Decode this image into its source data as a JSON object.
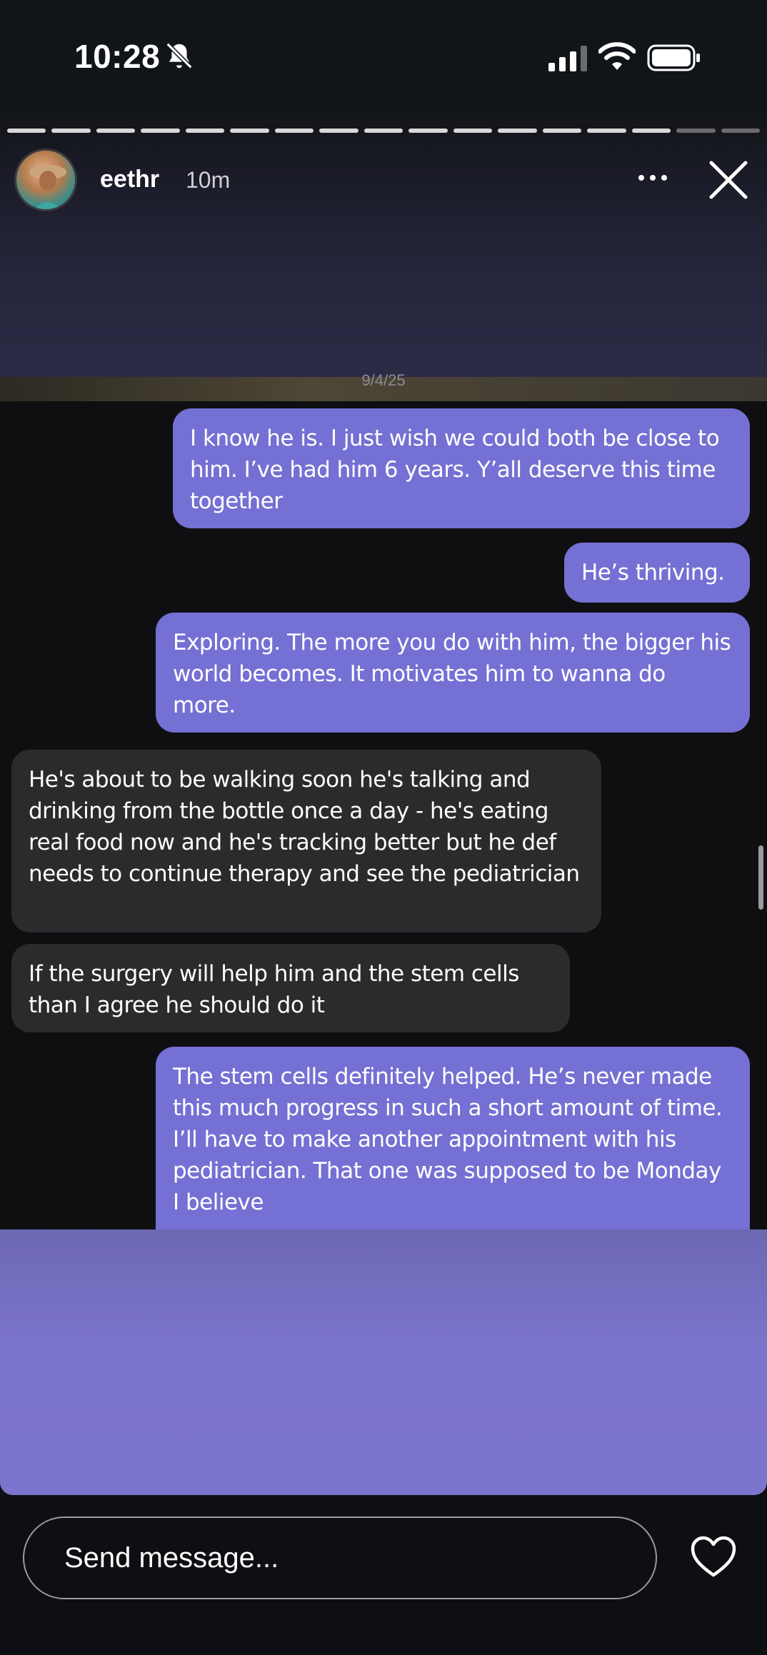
{
  "status_bar": {
    "time": "10:28",
    "icons": [
      "bell-off-icon",
      "cellular-signal-icon",
      "wifi-icon",
      "battery-icon"
    ]
  },
  "story": {
    "username": "eethr",
    "age": "10m",
    "progress": {
      "total_segments": 17,
      "completed_segments": 15
    },
    "icons": [
      "more-icon",
      "close-icon"
    ]
  },
  "screenshot": {
    "date": "9/4/25",
    "messages": [
      {
        "side": "sent",
        "text": "I know he is. I just wish we could both be close to him. I’ve had him 6 years. Y’all deserve this time together"
      },
      {
        "side": "sent",
        "text": "He’s thriving."
      },
      {
        "side": "sent",
        "text": "Exploring. The more you do with him, the bigger his world becomes. It motivates him to wanna do more."
      },
      {
        "side": "received",
        "text": "He's about to be walking soon he's talking and drinking from the bottle once a day - he's eating real food now and he's tracking better but he def needs to continue therapy and see the pediatrician"
      },
      {
        "side": "received",
        "text": "If the surgery will help him and the stem cells than I agree he should do it"
      },
      {
        "side": "sent",
        "text": "The stem cells definitely helped. He’s never made this much progress in such a short amount of time. I’ll have to make another appointment with his pediatrician. That one was supposed to be Monday I believe"
      }
    ]
  },
  "footer": {
    "placeholder": "Send message...",
    "icons": [
      "heart-icon"
    ]
  },
  "colors": {
    "sent_bubble": "#7570d3",
    "received_bubble": "#2b2b2e",
    "background": "#0d0f12"
  }
}
